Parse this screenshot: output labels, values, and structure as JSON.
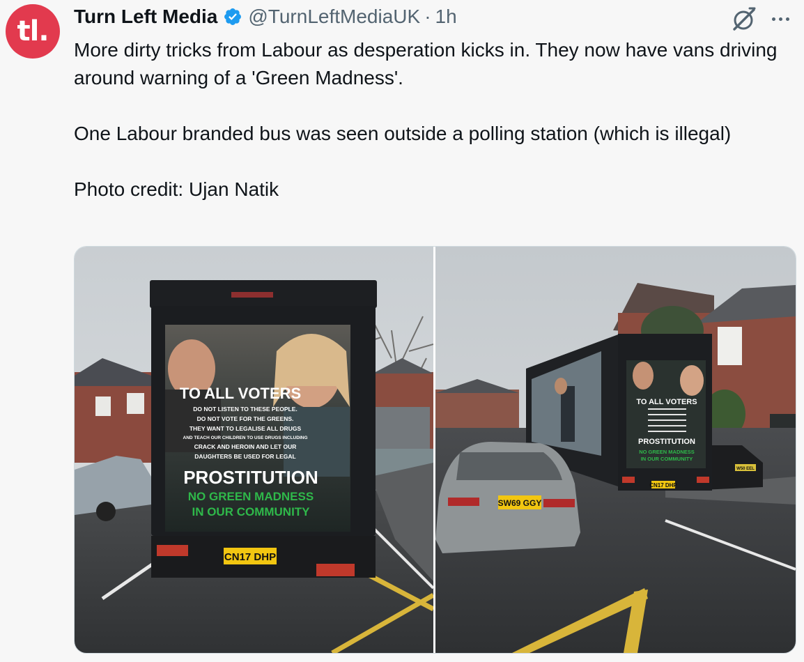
{
  "tweet": {
    "avatar_text": "tl.",
    "display_name": "Turn Left Media",
    "handle": "@TurnLeftMediaUK",
    "separator": "·",
    "time": "1h",
    "text_lines": [
      "More dirty tricks from Labour as desperation kicks in. They now have vans driving around warning of a 'Green Madness'.",
      "One Labour branded bus was seen outside a polling station (which is illegal)",
      "Photo credit: Ujan Natik"
    ],
    "icons": [
      "verified-badge-icon",
      "grok-icon",
      "more-icon"
    ],
    "colors": {
      "avatar_bg": "#e23a4e",
      "verified": "#1d9bf0",
      "secondary_text": "#536471"
    }
  },
  "media": {
    "left_photo": {
      "billboard": {
        "headline": "TO ALL VOTERS",
        "lines": [
          "DO NOT LISTEN TO THESE PEOPLE.",
          "DO NOT VOTE FOR THE GREENS.",
          "THEY WANT TO LEGALISE ALL DRUGS",
          "AND TEACH OUR CHILDREN TO USE DRUGS INCLUDING",
          "CRACK AND HEROIN AND LET OUR",
          "DAUGHTERS BE USED FOR LEGAL"
        ],
        "big_word": "PROSTITUTION",
        "green_lines": [
          "NO GREEN MADNESS",
          "IN OUR COMMUNITY"
        ]
      },
      "plate": "CN17 DHP"
    },
    "right_photo": {
      "billboard": {
        "headline": "TO ALL VOTERS",
        "big_word": "PROSTITUTION",
        "green_lines": [
          "NO GREEN MADNESS",
          "IN OUR COMMUNITY"
        ]
      },
      "van_plate": "CN17 DHP",
      "car_plate": "SW69 GGY",
      "other_plate": "W50 EEL"
    }
  }
}
